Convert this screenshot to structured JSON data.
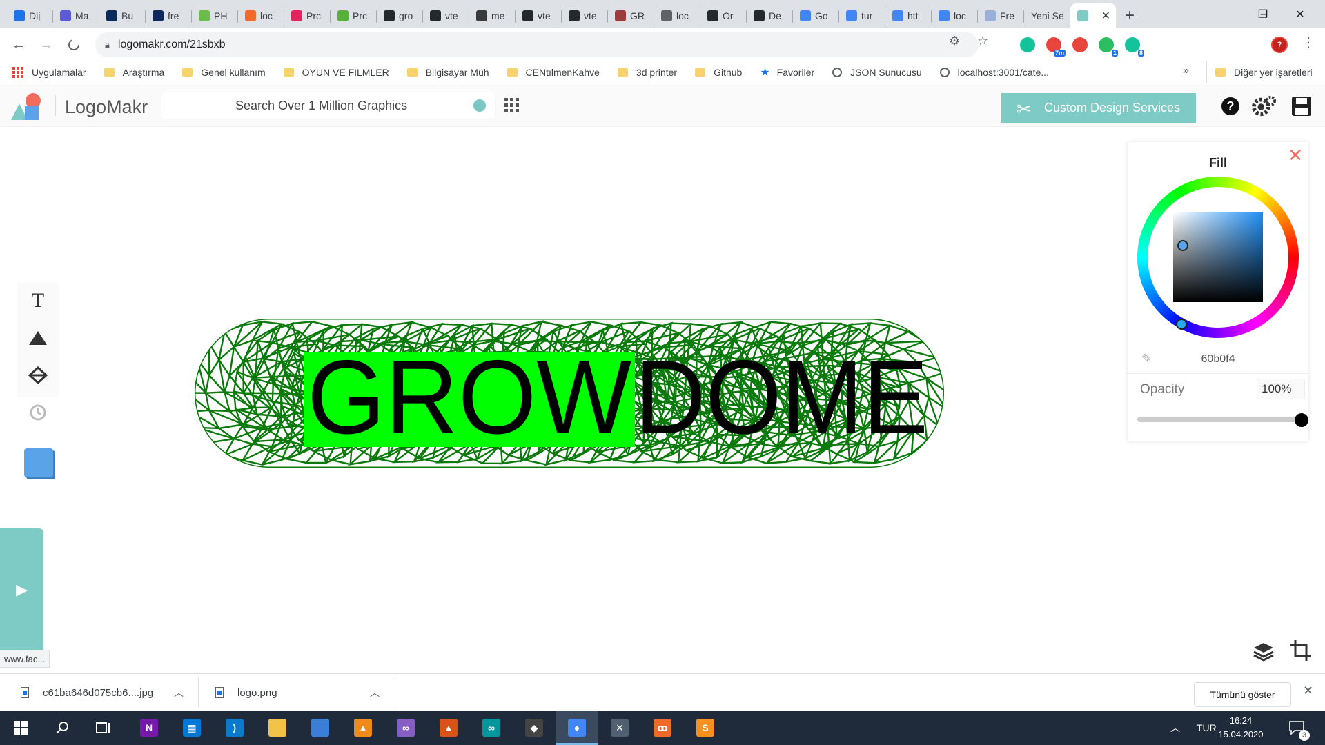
{
  "browser": {
    "tabs": [
      {
        "label": "Dij",
        "icon": "dijkstra-icon",
        "color": "#1a73e8"
      },
      {
        "label": "Ma",
        "icon": "medium-m-icon",
        "color": "#5b5bd6"
      },
      {
        "label": "Bu",
        "icon": "angular-icon",
        "color": "#0b2a5b"
      },
      {
        "label": "fre",
        "icon": "angular-icon",
        "color": "#0b2a5b"
      },
      {
        "label": "PH",
        "icon": "phpmyadmin-icon",
        "color": "#6dbb4a"
      },
      {
        "label": "loc",
        "icon": "xampp-icon",
        "color": "#f26a2a"
      },
      {
        "label": "Prc",
        "icon": "udemy-icon",
        "color": "#e0245e"
      },
      {
        "label": "Prc",
        "icon": "upwork-icon",
        "color": "#57b03c"
      },
      {
        "label": "gro",
        "icon": "github-icon",
        "color": "#24292e"
      },
      {
        "label": "vte",
        "icon": "github-icon",
        "color": "#24292e"
      },
      {
        "label": "me",
        "icon": "medium-icon",
        "color": "#3a3a3a"
      },
      {
        "label": "vte",
        "icon": "github-icon",
        "color": "#24292e"
      },
      {
        "label": "vte",
        "icon": "github-icon",
        "color": "#24292e"
      },
      {
        "label": "GR",
        "icon": "shield-icon",
        "color": "#9c3b3b"
      },
      {
        "label": "loc",
        "icon": "globe-icon",
        "color": "#5f6368"
      },
      {
        "label": "Or",
        "icon": "github-icon",
        "color": "#24292e"
      },
      {
        "label": "De",
        "icon": "github-icon",
        "color": "#24292e"
      },
      {
        "label": "Go",
        "icon": "google-translate-icon",
        "color": "#4285f4"
      },
      {
        "label": "tur",
        "icon": "google-icon",
        "color": "#4285f4"
      },
      {
        "label": "htt",
        "icon": "google-icon",
        "color": "#4285f4"
      },
      {
        "label": "loc",
        "icon": "google-icon",
        "color": "#4285f4"
      },
      {
        "label": "Fre",
        "icon": "shapes-icon",
        "color": "#9ab0d9"
      },
      {
        "label": "Yeni Se",
        "icon": "",
        "color": ""
      },
      {
        "label": "",
        "icon": "logomakr-icon",
        "color": "#7ecbc6",
        "active": true
      }
    ],
    "new_tab": "+",
    "window": {
      "minimize": "–",
      "maximize": "❐",
      "close": "✕"
    },
    "url": "logomakr.com/21sbxb",
    "bookmarks": [
      {
        "label": "Uygulamalar",
        "type": "apps"
      },
      {
        "label": "Araştırma",
        "type": "folder"
      },
      {
        "label": "Genel kullanım",
        "type": "folder"
      },
      {
        "label": "OYUN VE FİLMLER",
        "type": "folder"
      },
      {
        "label": "Bilgisayar Müh",
        "type": "folder"
      },
      {
        "label": "CENtılmenKahve",
        "type": "folder"
      },
      {
        "label": "3d printer",
        "type": "folder"
      },
      {
        "label": "Github",
        "type": "folder"
      },
      {
        "label": "Favoriler",
        "type": "star"
      },
      {
        "label": "JSON Sunucusu",
        "type": "globe"
      },
      {
        "label": "localhost:3001/cate...",
        "type": "globe"
      }
    ],
    "bookmarks_more": "»",
    "other_bookmarks": "Diğer yer işaretleri",
    "extensions": [
      {
        "icon": "grammarly-icon",
        "color": "#15c39a",
        "badge": ""
      },
      {
        "icon": "weather-icon",
        "color": "#e8453c",
        "badge": "7m"
      },
      {
        "icon": "pokeball-icon",
        "color": "#e8453c",
        "badge": ""
      },
      {
        "icon": "evernote-icon",
        "color": "#2dbe60",
        "badge": "1"
      },
      {
        "icon": "grammarly-icon",
        "color": "#15c39a",
        "badge": "8"
      }
    ],
    "status_url": "www.fac..."
  },
  "app": {
    "brand": "LogoMakr",
    "search": {
      "placeholder": "Search Over 1 Million Graphics",
      "value": ""
    },
    "custom_design_label": "Custom Design Services",
    "logo_text": {
      "part1": "GROW",
      "part2": "DOME"
    },
    "colors": {
      "highlight": "#00ff00",
      "mesh": "#0a7a0a",
      "swatch": "#5aa3e8",
      "accent": "#7ecbc6"
    },
    "fill_panel": {
      "title": "Fill",
      "hex": "60b0f4",
      "opacity_label": "Opacity",
      "opacity_value": "100%",
      "opacity_level": 1.0
    }
  },
  "downloads": {
    "items": [
      {
        "name": "c61ba646d075cb6....jpg"
      },
      {
        "name": "logo.png"
      }
    ],
    "show_all": "Tümünü göster"
  },
  "taskbar": {
    "apps": [
      {
        "icon": "onenote-icon",
        "color": "#7719aa",
        "glyph": "N"
      },
      {
        "icon": "store-icon",
        "color": "#0078d7",
        "glyph": "▦"
      },
      {
        "icon": "vscode-icon",
        "color": "#0a7acc",
        "glyph": "⟩"
      },
      {
        "icon": "file-explorer-icon",
        "color": "#f2c14a",
        "glyph": ""
      },
      {
        "icon": "network-icon",
        "color": "#3b7ed8",
        "glyph": ""
      },
      {
        "icon": "vlc-icon",
        "color": "#f08a1c",
        "glyph": "▲"
      },
      {
        "icon": "visual-studio-icon",
        "color": "#865fc5",
        "glyph": "∞"
      },
      {
        "icon": "matlab-icon",
        "color": "#d95319",
        "glyph": "▲"
      },
      {
        "icon": "arduino-icon",
        "color": "#00979d",
        "glyph": "∞"
      },
      {
        "icon": "unity-icon",
        "color": "#444",
        "glyph": "◆"
      },
      {
        "icon": "chrome-icon",
        "color": "#4285f4",
        "glyph": "●",
        "active": true
      },
      {
        "icon": "cross-icon",
        "color": "#506070",
        "glyph": "✕"
      },
      {
        "icon": "xampp-icon",
        "color": "#f26a2a",
        "glyph": "ꝏ"
      },
      {
        "icon": "sublime-icon",
        "color": "#f98f1d",
        "glyph": "S"
      }
    ],
    "language": "TUR",
    "time": "16:24",
    "date": "15.04.2020",
    "notifications": "3"
  }
}
